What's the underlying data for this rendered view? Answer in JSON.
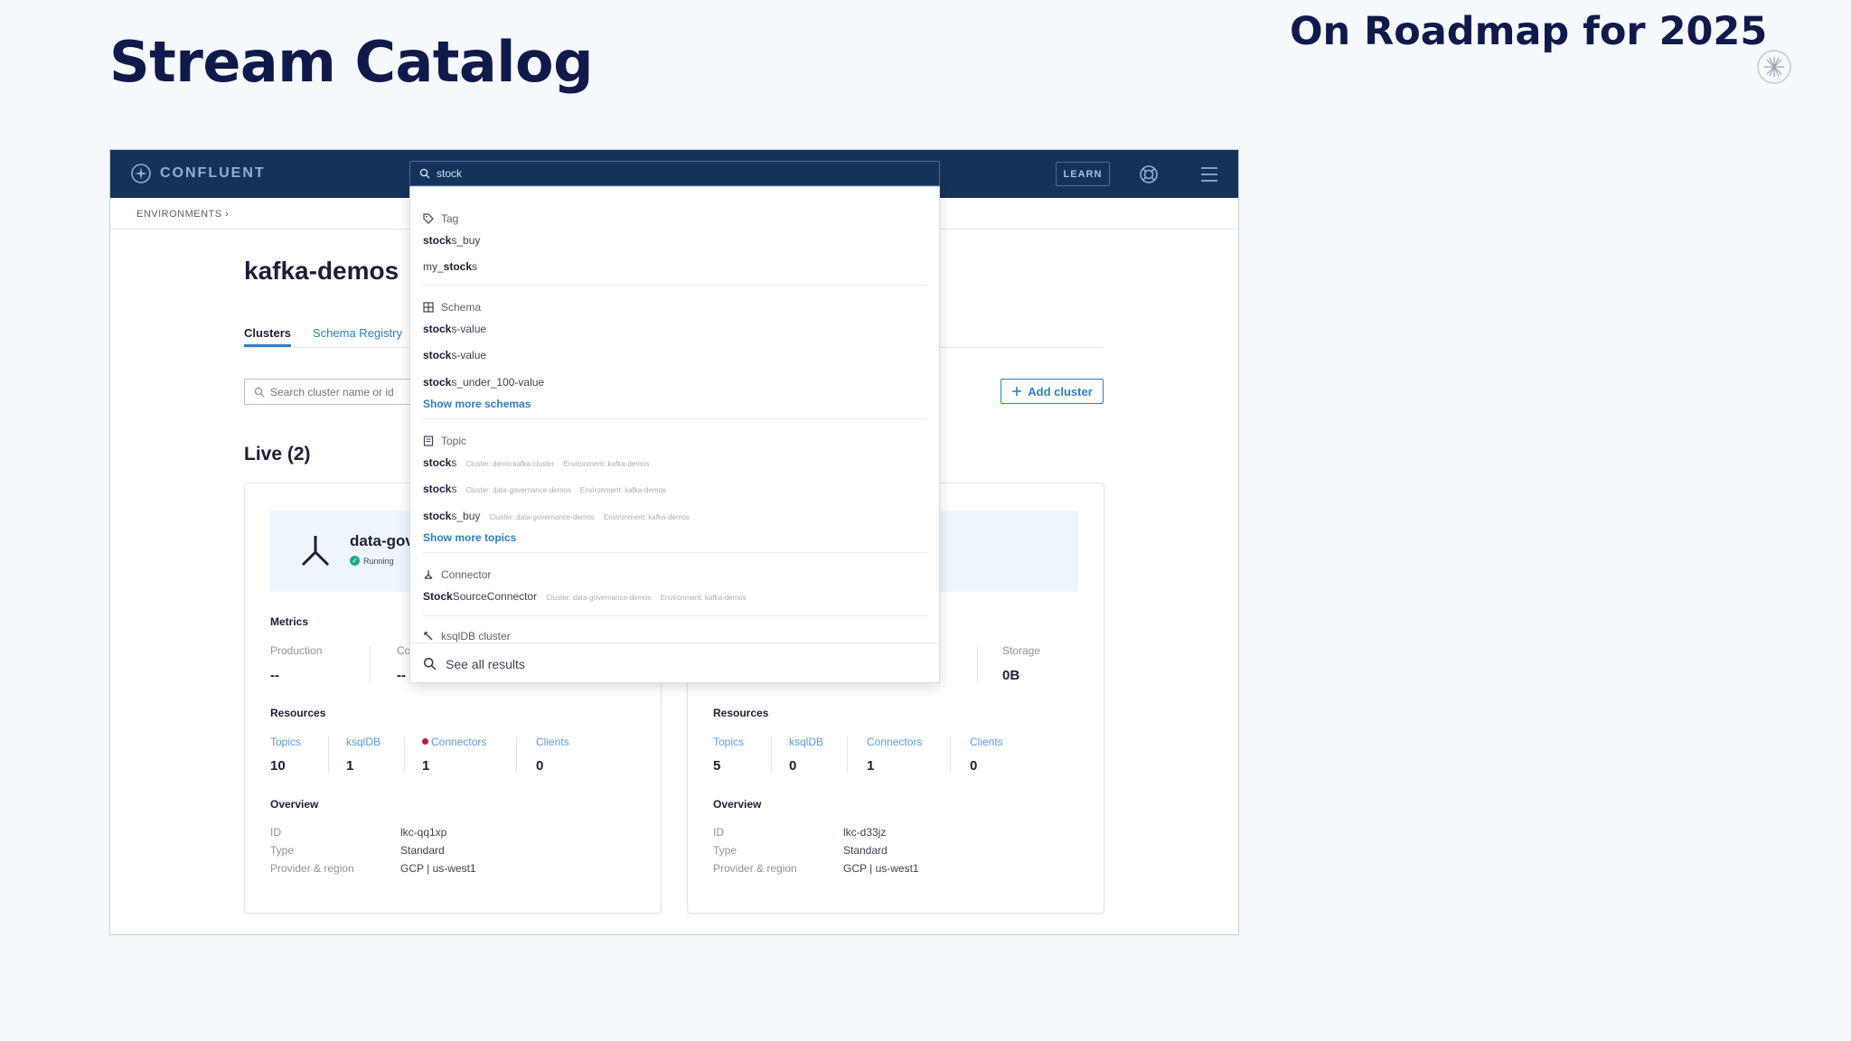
{
  "slide": {
    "title": "Stream Catalog",
    "roadmap": "On Roadmap for 2025"
  },
  "app": {
    "brand": "CONFLUENT",
    "learn": "LEARN",
    "breadcrumb": "ENVIRONMENTS  ›",
    "env_title": "kafka-demos",
    "tabs": {
      "clusters": "Clusters",
      "schema": "Schema Registry"
    },
    "cluster_search_placeholder": "Search cluster name or id",
    "add_cluster": "Add cluster",
    "live": "Live (2)"
  },
  "search": {
    "query": "stock",
    "groups": {
      "tag": "Tag",
      "schema": "Schema",
      "topic": "Topic",
      "connector": "Connector",
      "ksqldb": "ksqlDB cluster"
    },
    "tag_results": [
      {
        "bold": "stock",
        "rest": "s_buy"
      },
      {
        "pre": "my_",
        "bold": "stock",
        "rest": "s"
      }
    ],
    "schema_results": [
      {
        "bold": "stock",
        "rest": "s-value"
      },
      {
        "bold": "stock",
        "rest": "s-value"
      },
      {
        "bold": "stock",
        "rest": "s_under_100-value"
      }
    ],
    "show_more_schemas": "Show more schemas",
    "topic_results": [
      {
        "bold": "stock",
        "rest": "s",
        "cluster": "Cluster: demo-kafka-cluster",
        "env": "Environment: kafka-demos"
      },
      {
        "bold": "stock",
        "rest": "s",
        "cluster": "Cluster: data-governance-demos",
        "env": "Environment: kafka-demos"
      },
      {
        "bold": "stock",
        "rest": "s_buy",
        "cluster": "Cluster: data-governance-demos",
        "env": "Environment: kafka-demos"
      }
    ],
    "show_more_topics": "Show more topics",
    "connector_results": [
      {
        "bold": "Stock",
        "rest": "SourceConnector",
        "cluster": "Cluster: data-governance-demos",
        "env": "Environment: kafka-demos"
      }
    ],
    "see_all": "See all results"
  },
  "cards": {
    "left": {
      "name": "data-gov",
      "status": "Running",
      "metrics_label": "Metrics",
      "metrics": [
        {
          "label": "Production",
          "value": "--"
        },
        {
          "label": "Co",
          "value": "--"
        }
      ],
      "resources_label": "Resources",
      "resources": [
        {
          "label": "Topics",
          "value": "10"
        },
        {
          "label": "ksqlDB",
          "value": "1"
        },
        {
          "label": "Connectors",
          "value": "1"
        },
        {
          "label": "Clients",
          "value": "0"
        }
      ],
      "overview_label": "Overview",
      "overview": [
        {
          "key": "ID",
          "value": "lkc-qq1xp"
        },
        {
          "key": "Type",
          "value": "Standard"
        },
        {
          "key": "Provider & region",
          "value": "GCP | us-west1"
        }
      ]
    },
    "right": {
      "metrics": [
        {
          "label": "Storage",
          "value": "0B"
        }
      ],
      "resources_label": "Resources",
      "resources": [
        {
          "label": "Topics",
          "value": "5"
        },
        {
          "label": "ksqlDB",
          "value": "0"
        },
        {
          "label": "Connectors",
          "value": "1"
        },
        {
          "label": "Clients",
          "value": "0"
        }
      ],
      "overview_label": "Overview",
      "overview": [
        {
          "key": "ID",
          "value": "lkc-d33jz"
        },
        {
          "key": "Type",
          "value": "Standard"
        },
        {
          "key": "Provider & region",
          "value": "GCP | us-west1"
        }
      ]
    }
  },
  "colors": {
    "nav": "#15325a",
    "accent": "#2f7ec3",
    "title": "#0f1a4a",
    "running": "#1ea891",
    "alert": "#c0183e"
  },
  "icons": [
    "confluent-logo-icon",
    "search-icon",
    "help-icon",
    "menu-icon",
    "tag-icon",
    "schema-icon",
    "topic-icon",
    "connector-icon",
    "ksqldb-icon",
    "plus-icon",
    "cluster-icon",
    "check-icon",
    "corner-logo-icon"
  ]
}
